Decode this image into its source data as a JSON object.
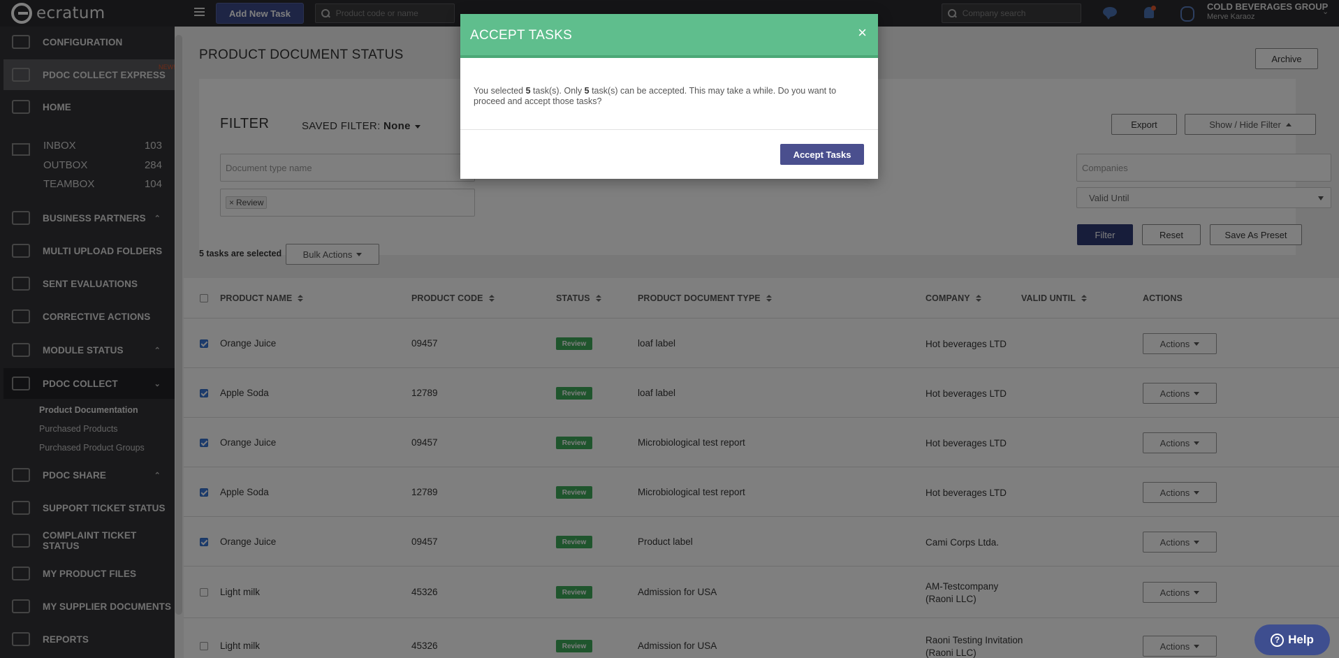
{
  "app": {
    "logo_text": "ecratum"
  },
  "topbar": {
    "add_task_label": "Add New Task",
    "product_search_placeholder": "Product code or name",
    "company_search_placeholder": "Company search",
    "company_name": "COLD BEVERAGES GROUP",
    "user_name": "Merve Karaoz"
  },
  "sidebar": {
    "configuration": "CONFIGURATION",
    "pdoc_express": "PDOC COLLECT EXPRESS",
    "new_badge": "NEW!",
    "home": "HOME",
    "inbox": {
      "label": "INBOX",
      "count": "103"
    },
    "outbox": {
      "label": "OUTBOX",
      "count": "284"
    },
    "teambox": {
      "label": "TEAMBOX",
      "count": "104"
    },
    "business_partners": "BUSINESS PARTNERS",
    "multi_upload": "MULTI UPLOAD FOLDERS",
    "sent_evaluations": "SENT EVALUATIONS",
    "corrective_actions": "CORRECTIVE ACTIONS",
    "module_status": "MODULE STATUS",
    "pdoc_collect": "PDOC COLLECT",
    "sub_product_documentation": "Product Documentation",
    "sub_purchased_products": "Purchased Products",
    "sub_purchased_groups": "Purchased Product Groups",
    "pdoc_share": "PDOC SHARE",
    "support_ticket": "SUPPORT TICKET STATUS",
    "complaint_ticket": "COMPLAINT TICKET STATUS",
    "my_product_files": "MY PRODUCT FILES",
    "my_supplier_docs": "MY SUPPLIER DOCUMENTS",
    "reports": "REPORTS"
  },
  "page": {
    "title": "PRODUCT DOCUMENT STATUS",
    "archive_label": "Archive"
  },
  "filter": {
    "title": "FILTER",
    "saved_filter_prefix": "SAVED FILTER:",
    "saved_filter_value": "None",
    "export_label": "Export",
    "show_hide_label": "Show / Hide Filter",
    "document_type_placeholder": "Document type name",
    "companies_placeholder": "Companies",
    "status_tag": "Review",
    "valid_until_placeholder": "Valid Until",
    "filter_label": "Filter",
    "reset_label": "Reset",
    "save_preset_label": "Save As Preset"
  },
  "selection": {
    "selected_text": "5 tasks are selected",
    "bulk_actions_label": "Bulk Actions"
  },
  "table": {
    "headers": {
      "product_name": "PRODUCT NAME",
      "product_code": "PRODUCT CODE",
      "status": "STATUS",
      "document_type": "PRODUCT DOCUMENT TYPE",
      "company": "COMPANY",
      "valid_until": "VALID UNTIL",
      "actions": "ACTIONS"
    },
    "actions_label": "Actions",
    "rows": [
      {
        "name": "Orange Juice",
        "code": "09457",
        "status": "Review",
        "type": "loaf label",
        "company": "Hot beverages LTD",
        "checked": true
      },
      {
        "name": "Apple Soda",
        "code": "12789",
        "status": "Review",
        "type": "loaf label",
        "company": "Hot beverages LTD",
        "checked": true
      },
      {
        "name": "Orange Juice",
        "code": "09457",
        "status": "Review",
        "type": "Microbiological test report",
        "company": "Hot beverages LTD",
        "checked": true
      },
      {
        "name": "Apple Soda",
        "code": "12789",
        "status": "Review",
        "type": "Microbiological test report",
        "company": "Hot beverages LTD",
        "checked": true
      },
      {
        "name": "Orange Juice",
        "code": "09457",
        "status": "Review",
        "type": "Product label",
        "company": "Cami Corps Ltda.",
        "checked": true
      },
      {
        "name": "Light milk",
        "code": "45326",
        "status": "Review",
        "type": "Admission for USA",
        "company": "AM-Testcompany (Raoni LLC)",
        "checked": false
      },
      {
        "name": "Light milk",
        "code": "45326",
        "status": "Review",
        "type": "Admission for USA",
        "company": "Raoni Testing Invitation (Raoni LLC)",
        "checked": false
      }
    ]
  },
  "modal": {
    "title": "ACCEPT TASKS",
    "close_glyph": "×",
    "body_part1": "You selected ",
    "selected_count": "5",
    "body_part2": " task(s). Only ",
    "acceptable_count": "5",
    "body_part3": " task(s) can be accepted. This may take a while. Do you want to proceed and accept those tasks?",
    "accept_label": "Accept Tasks"
  },
  "help": {
    "label": "Help",
    "glyph": "?"
  },
  "colors": {
    "modal_header": "#5fbe8d",
    "primary": "#3c4b8a",
    "status_review": "#3eaa5b",
    "checkbox": "#3b78d8"
  }
}
